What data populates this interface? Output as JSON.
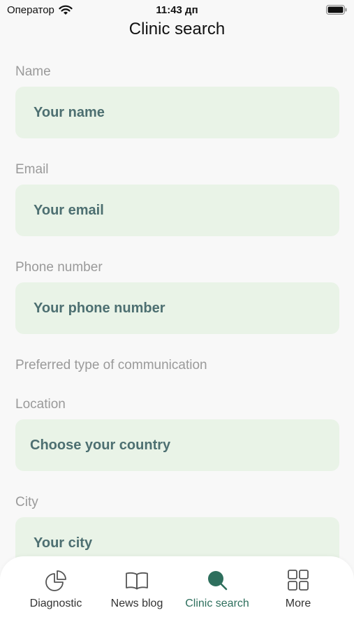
{
  "status_bar": {
    "carrier": "Оператор",
    "time": "11:43 дп"
  },
  "header": {
    "title": "Clinic search"
  },
  "form": {
    "name_label": "Name",
    "name_placeholder": "Your name",
    "email_label": "Email",
    "email_placeholder": "Your email",
    "phone_label": "Phone number",
    "phone_placeholder": "Your phone number",
    "communication_label": "Preferred type of communication",
    "location_label": "Location",
    "location_value": "Choose your country",
    "city_label": "City",
    "city_placeholder": "Your city"
  },
  "tabbar": {
    "items": [
      {
        "label": "Diagnostic",
        "icon": "pie-chart-icon"
      },
      {
        "label": "News blog",
        "icon": "open-book-icon"
      },
      {
        "label": "Clinic search",
        "icon": "search-icon"
      },
      {
        "label": "More",
        "icon": "grid-icon"
      }
    ],
    "active_index": 2
  },
  "colors": {
    "accent": "#2e6f5d",
    "field_background": "#e9f3e7",
    "field_text": "#4d6f71",
    "label_text": "#9a9a9a"
  }
}
